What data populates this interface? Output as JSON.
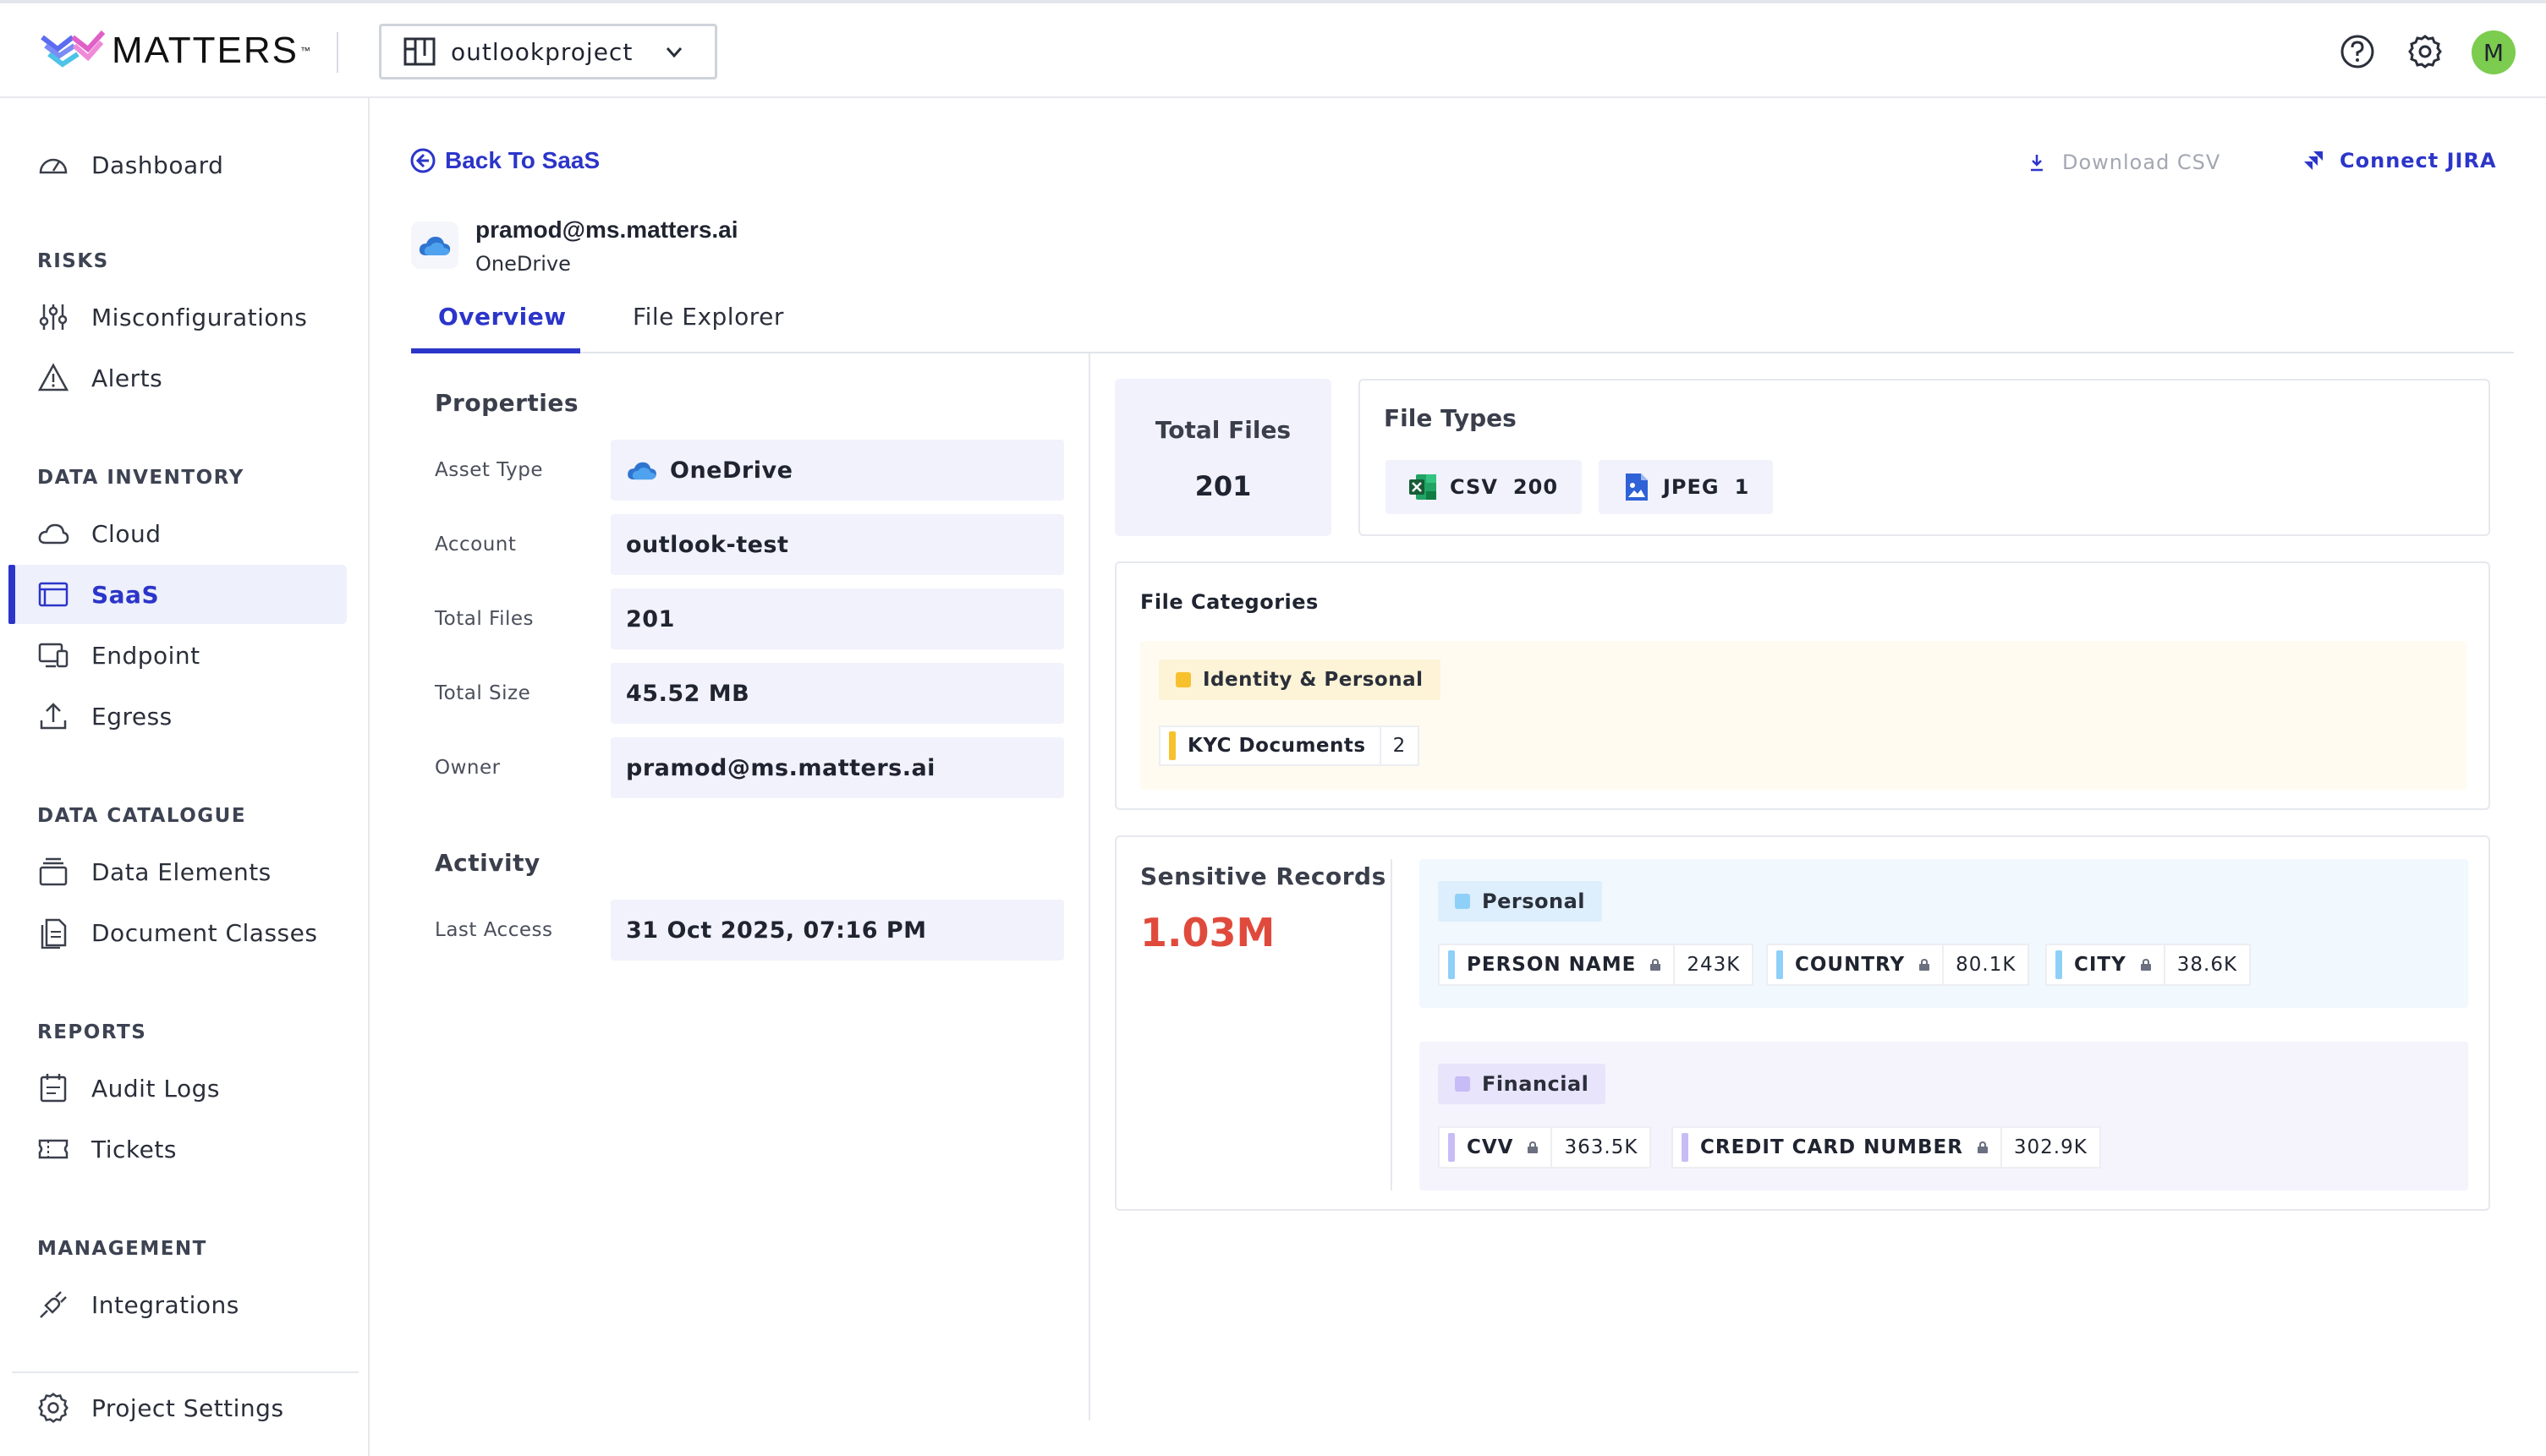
{
  "topbar": {
    "brand": "MATTERS",
    "brand_tm": "™",
    "project": "outlookproject",
    "avatar_initial": "M"
  },
  "sidebar": {
    "dashboard": "Dashboard",
    "sections": {
      "risks": "RISKS",
      "data_inventory": "DATA INVENTORY",
      "data_catalogue": "DATA CATALOGUE",
      "reports": "REPORTS",
      "management": "MANAGEMENT"
    },
    "items": {
      "misconfigurations": "Misconfigurations",
      "alerts": "Alerts",
      "cloud": "Cloud",
      "saas": "SaaS",
      "endpoint": "Endpoint",
      "egress": "Egress",
      "data_elements": "Data Elements",
      "document_classes": "Document Classes",
      "audit_logs": "Audit Logs",
      "tickets": "Tickets",
      "integrations": "Integrations",
      "project_settings": "Project Settings"
    },
    "active": "saas"
  },
  "header": {
    "back": "Back To SaaS",
    "download_csv": "Download CSV",
    "connect_jira": "Connect JIRA",
    "asset_email": "pramod@ms.matters.ai",
    "asset_type": "OneDrive"
  },
  "tabs": {
    "overview": "Overview",
    "file_explorer": "File Explorer",
    "active": "overview"
  },
  "properties": {
    "title": "Properties",
    "asset_type_label": "Asset Type",
    "asset_type_value": "OneDrive",
    "account_label": "Account",
    "account_value": "outlook-test",
    "total_files_label": "Total Files",
    "total_files_value": "201",
    "total_size_label": "Total Size",
    "total_size_value": "45.52 MB",
    "owner_label": "Owner",
    "owner_value": "pramod@ms.matters.ai"
  },
  "activity": {
    "title": "Activity",
    "last_access_label": "Last Access",
    "last_access_value": "31 Oct 2025, 07:16 PM"
  },
  "total_files_card": {
    "label": "Total Files",
    "value": "201"
  },
  "file_types": {
    "title": "File Types",
    "items": [
      {
        "type": "CSV",
        "count": "200",
        "icon": "excel-icon"
      },
      {
        "type": "JPEG",
        "count": "1",
        "icon": "image-file-icon"
      }
    ]
  },
  "file_categories": {
    "title": "File Categories",
    "group": "Identity & Personal",
    "items": [
      {
        "label": "KYC Documents",
        "count": "2"
      }
    ],
    "color": "#f7c12e"
  },
  "sensitive_records": {
    "title": "Sensitive Records",
    "total": "1.03M",
    "groups": [
      {
        "name": "Personal",
        "color": "#8fd0f8",
        "items": [
          {
            "label": "PERSON NAME",
            "count": "243K"
          },
          {
            "label": "COUNTRY",
            "count": "80.1K"
          },
          {
            "label": "CITY",
            "count": "38.6K"
          }
        ]
      },
      {
        "name": "Financial",
        "color": "#c7bcf5",
        "items": [
          {
            "label": "CVV",
            "count": "363.5K"
          },
          {
            "label": "CREDIT CARD NUMBER",
            "count": "302.9K"
          }
        ]
      }
    ]
  },
  "colors": {
    "accent": "#2c35c9",
    "danger": "#e04a3c",
    "avatar": "#7ccc4f"
  }
}
